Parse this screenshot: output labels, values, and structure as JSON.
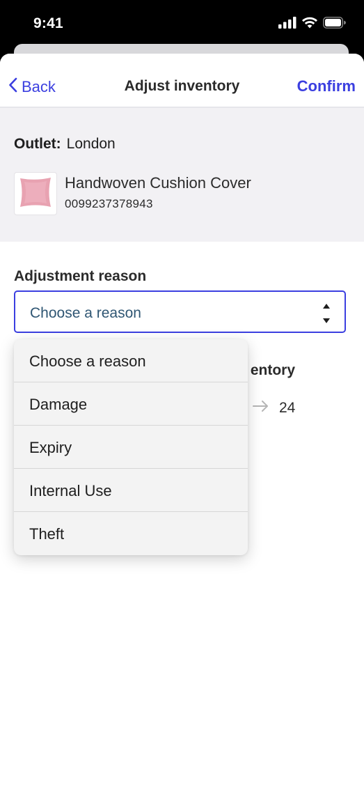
{
  "status_bar": {
    "time": "9:41"
  },
  "nav": {
    "back_label": "Back",
    "title": "Adjust inventory",
    "confirm_label": "Confirm"
  },
  "outlet": {
    "label": "Outlet:",
    "value": "London"
  },
  "product": {
    "name": "Handwoven Cushion Cover",
    "sku": "0099237378943"
  },
  "adjustment": {
    "label": "Adjustment reason",
    "selected": "Choose a reason",
    "options": [
      "Choose a reason",
      "Damage",
      "Expiry",
      "Internal Use",
      "Theft"
    ]
  },
  "inventory": {
    "heading_partial": "entory",
    "new_value": "24"
  },
  "colors": {
    "accent": "#3b3fe0",
    "panel": "#f2f1f4",
    "select_text": "#2f5673"
  }
}
